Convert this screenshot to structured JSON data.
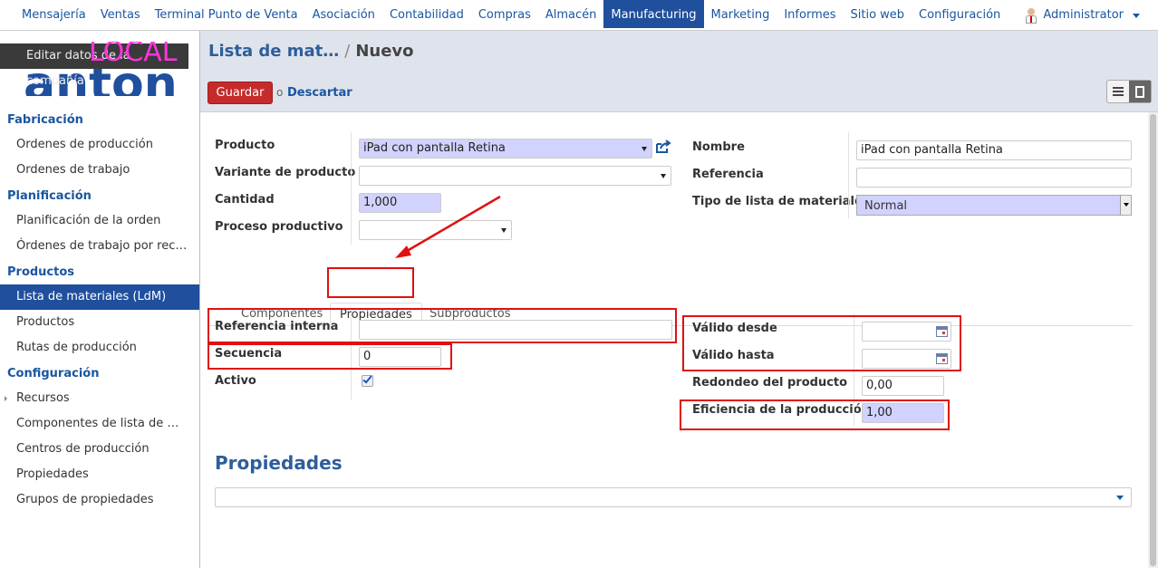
{
  "topnav": {
    "items": [
      "Mensajería",
      "Ventas",
      "Terminal Punto de Venta",
      "Asociación",
      "Contabilidad",
      "Compras",
      "Almacén",
      "Manufacturing",
      "Marketing",
      "Informes",
      "Sitio web",
      "Configuración"
    ],
    "active": "Manufacturing",
    "user": "Administrator"
  },
  "sidebar": {
    "logo_bar_text": "Editar datos de la compañía",
    "logo_text": "anton",
    "env_tag": "LOCAL",
    "sections": [
      {
        "title": "Fabricación",
        "items": [
          "Ordenes de producción",
          "Ordenes de trabajo"
        ]
      },
      {
        "title": "Planificación",
        "items": [
          "Planificación de la orden",
          "Órdenes de trabajo por rec…"
        ]
      },
      {
        "title": "Productos",
        "items": [
          "Lista de materiales (LdM)",
          "Productos",
          "Rutas de producción"
        ]
      },
      {
        "title": "Configuración",
        "items": [
          "Recursos",
          "Componentes de lista de …",
          "Centros de producción",
          "Propiedades",
          "Grupos de propiedades"
        ]
      }
    ],
    "active_item": "Lista de materiales (LdM)"
  },
  "header": {
    "breadcrumb_parent": "Lista de mat…",
    "breadcrumb_sep": "/",
    "breadcrumb_current": "Nuevo",
    "save_label": "Guardar",
    "or_label": "o",
    "discard_label": "Descartar"
  },
  "form": {
    "producto_label": "Producto",
    "producto_value": "iPad con pantalla Retina",
    "variante_label": "Variante de producto",
    "variante_value": "",
    "cantidad_label": "Cantidad",
    "cantidad_value": "1,000",
    "proceso_label": "Proceso productivo",
    "proceso_value": "",
    "nombre_label": "Nombre",
    "nombre_value": "iPad con pantalla Retina",
    "referencia_label": "Referencia",
    "referencia_value": "",
    "tipo_label": "Tipo de lista de materiales",
    "tipo_value": "Normal"
  },
  "tabs": {
    "items": [
      "Componentes",
      "Propiedades",
      "Subproductos"
    ],
    "active": "Propiedades"
  },
  "props": {
    "ref_interna_label": "Referencia interna",
    "ref_interna_value": "",
    "secuencia_label": "Secuencia",
    "secuencia_value": "0",
    "activo_label": "Activo",
    "activo_checked": true,
    "valido_desde_label": "Válido desde",
    "valido_desde_value": "",
    "valido_hasta_label": "Válido hasta",
    "valido_hasta_value": "",
    "redondeo_label": "Redondeo del producto",
    "redondeo_value": "0,00",
    "eficiencia_label": "Eficiencia de la producción",
    "eficiencia_value": "1,00"
  },
  "properties_section": {
    "title": "Propiedades",
    "value": ""
  },
  "colors": {
    "accent": "#1f4f9d",
    "link": "#1a56a0",
    "save": "#c62a2a",
    "required": "#d2d2ff",
    "annotation": "#e01010",
    "env_tag": "#ff33dd"
  }
}
